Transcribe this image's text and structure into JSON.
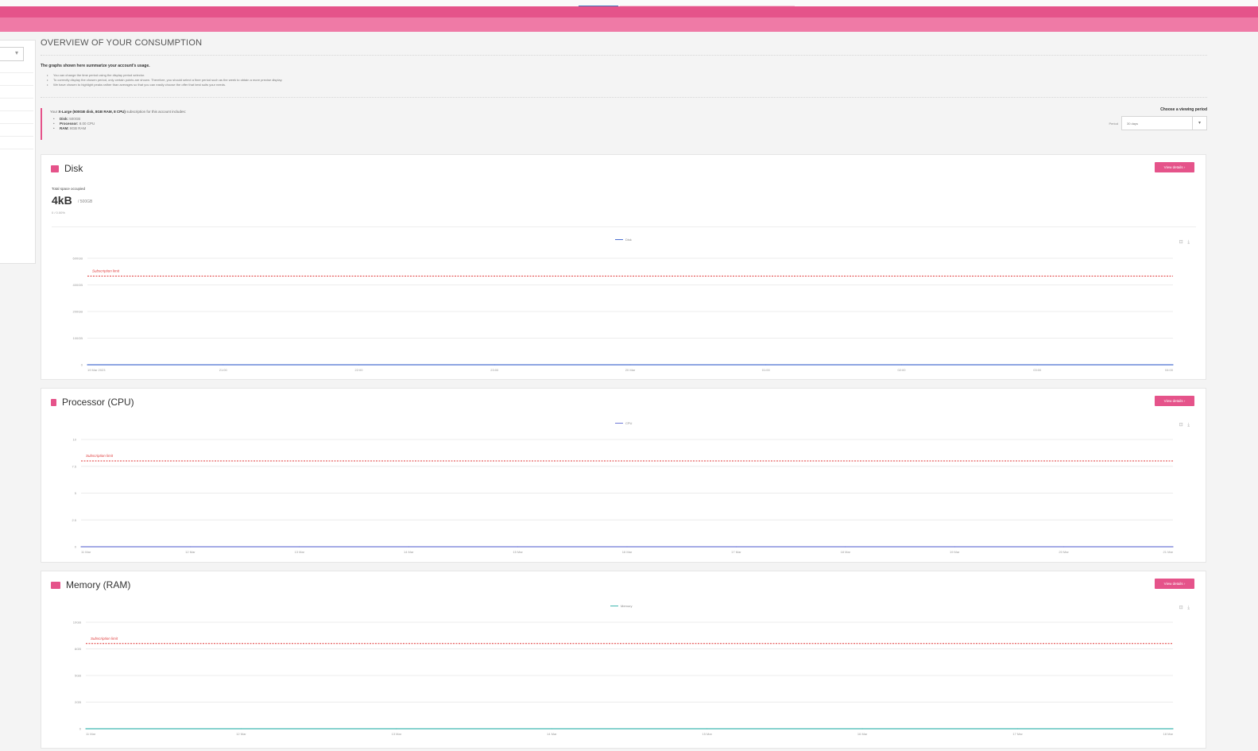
{
  "header": {
    "colors": {
      "band_dark": "#e5538a",
      "band_light": "#ef7aa6"
    }
  },
  "overview": {
    "title": "OVERVIEW OF YOUR CONSUMPTION",
    "intro": "The graphs shown here summarize your account's usage.",
    "bullets": [
      "You can change the time period using the display period selector.",
      "To correctly display the chosen period, only certain points are shown. Therefore, you should select a finer period such as the week to obtain a more precise display.",
      "We have chosen to highlight peaks rather than averages so that you can easily choose the offer that best suits your needs."
    ]
  },
  "subscription": {
    "headline_bold": "X-Large (500GB disk, 8GB RAM, 8 CPU)",
    "headline_prefix": "Your",
    "headline_suffix": "subscription for this account includes:",
    "items": [
      {
        "label": "Disk:",
        "value": "500GB"
      },
      {
        "label": "Processor:",
        "value": "8.00 CPU"
      },
      {
        "label": "RAM:",
        "value": "8GB RAM"
      }
    ]
  },
  "period": {
    "title": "Choose a viewing period",
    "label": "Period",
    "selected": "30 days"
  },
  "panels": {
    "disk": {
      "title": "Disk",
      "details_button": "View details ›",
      "total_label": "Total space occupied",
      "total_value": "4kB",
      "total_max": "/ 500GB",
      "total_pct": "0 / 0.00%",
      "legend": "Disk",
      "tools": "⊡ ⤓"
    },
    "cpu": {
      "title": "Processor (CPU)",
      "details_button": "View details ›",
      "legend": "CPU",
      "tools": "⊡ ⤓"
    },
    "ram": {
      "title": "Memory (RAM)",
      "details_button": "View details ›",
      "legend": "Memory",
      "tools": "⊡ ⤓"
    }
  },
  "chart_data": [
    {
      "type": "line",
      "name_ref": "disk",
      "limit_label": "Subscription limit",
      "limit_value": 500,
      "ylim": [
        0,
        600
      ],
      "yticks": [
        "0",
        "100GB",
        "200GB",
        "400GB",
        "600GB"
      ],
      "ytick_values": [
        0,
        150,
        300,
        450,
        600
      ],
      "x": [
        "19 Mar 2023",
        "21:00",
        "22:00",
        "23:00",
        "20 Mar",
        "01:00",
        "02:00",
        "03:00",
        "04:00"
      ],
      "series": [
        {
          "name": "Disk",
          "values": [
            0,
            0,
            0,
            0,
            0,
            0,
            0,
            0,
            0
          ],
          "color": "#4a6fd1"
        }
      ],
      "limit_color": "#e03a3a"
    },
    {
      "type": "line",
      "name_ref": "cpu",
      "limit_label": "Subscription limit",
      "limit_value": 8,
      "ylim": [
        0,
        10
      ],
      "yticks": [
        "0",
        "2.5",
        "5",
        "7.5",
        "10"
      ],
      "ytick_values": [
        0,
        2.5,
        5,
        7.5,
        10
      ],
      "x": [
        "11 Mar",
        "12 Mar",
        "13 Mar",
        "14 Mar",
        "15 Mar",
        "16 Mar",
        "17 Mar",
        "18 Mar",
        "19 Mar",
        "20 Mar",
        "21 Mar"
      ],
      "series": [
        {
          "name": "CPU",
          "values": [
            0,
            0,
            0,
            0,
            0,
            0,
            0,
            0,
            0,
            0,
            0
          ],
          "color": "#6e78d6"
        }
      ],
      "limit_color": "#e03a3a"
    },
    {
      "type": "line",
      "name_ref": "ram",
      "limit_label": "Subscription limit",
      "limit_value": 8,
      "ylim": [
        0,
        10
      ],
      "yticks": [
        "0",
        "2GB",
        "5GB",
        "8GB",
        "10GB"
      ],
      "ytick_values": [
        0,
        2.5,
        5,
        7.5,
        10
      ],
      "x": [
        "11 Mar",
        "12 Mar",
        "13 Mar",
        "14 Mar",
        "15 Mar",
        "16 Mar",
        "17 Mar",
        "18 Mar"
      ],
      "series": [
        {
          "name": "Memory",
          "values": [
            0,
            0,
            0,
            0,
            0,
            0,
            0,
            0
          ],
          "color": "#3fb6b0"
        }
      ],
      "limit_color": "#e03a3a"
    }
  ]
}
